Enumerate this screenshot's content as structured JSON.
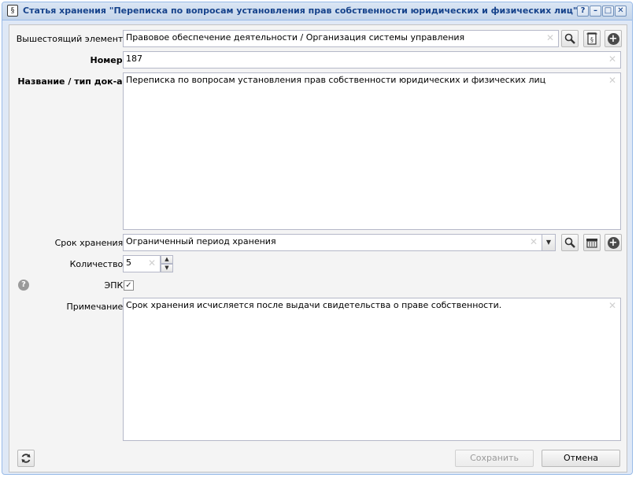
{
  "window": {
    "title": "Статья хранения \"Переписка по вопросам установления прав собственности юридических и физических лиц\"",
    "buttons": {
      "help": "?",
      "minimize": "–",
      "maximize": "□",
      "close": "✕"
    }
  },
  "form": {
    "parent": {
      "label": "Вышестоящий элемент:",
      "value": "Правовое обеспечение деятельности / Организация системы управления"
    },
    "number": {
      "label": "Номер:",
      "value": "187"
    },
    "name": {
      "label": "Название / тип док-а:",
      "value": "Переписка по вопросам установления прав собственности юридических и физических лиц"
    },
    "retention": {
      "label": "Срок хранения:",
      "value": "Ограниченный период хранения"
    },
    "quantity": {
      "label": "Количество:",
      "value": "5"
    },
    "epk": {
      "label": "ЭПК:",
      "checked": true
    },
    "note": {
      "label": "Примечание:",
      "value": "Срок хранения исчисляется после выдачи свидетельства о праве собственности."
    }
  },
  "footer": {
    "save_label": "Сохранить",
    "cancel_label": "Отмена"
  },
  "icons": {
    "search": "search-icon",
    "document": "document-icon",
    "add": "add-circle-icon",
    "refresh": "refresh-icon",
    "help": "help-icon"
  }
}
